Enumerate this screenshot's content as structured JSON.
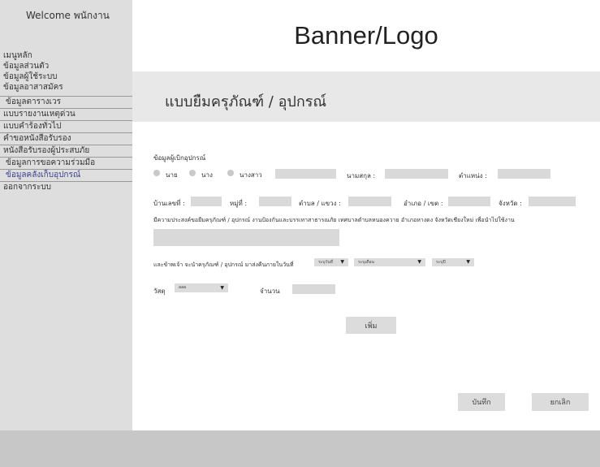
{
  "sidebar": {
    "welcome": "Welcome พนักงาน",
    "items": [
      {
        "label": "เมนูหลัก"
      },
      {
        "label": "ข้อมูลส่วนตัว"
      },
      {
        "label": "ข้อมูลผู้ใช้ระบบ"
      },
      {
        "label": "ข้อมูลอาสาสมัคร"
      },
      {
        "label": "ข้อมูลตารางเวร"
      },
      {
        "label": "แบบรายงานเหตุด่วน"
      },
      {
        "label": "แบบคำร้องทั่วไป"
      },
      {
        "label": "คำขอหนังสือรับรอง"
      },
      {
        "label": "หนังสือรับรองผู้ประสบภัย"
      },
      {
        "label": "ข้อมูลการขอความร่วมมือ"
      },
      {
        "label": "ข้อมูลคลังเก็บอุปกรณ์"
      },
      {
        "label": "ออกจากระบบ"
      }
    ]
  },
  "banner": {
    "text": "Banner/Logo"
  },
  "page": {
    "title": "แบบยืมครุภัณฑ์ / อุปกรณ์"
  },
  "form": {
    "section_label": "ข้อมูลผู้เบิกอุปกรณ์",
    "prefix_options": [
      "นาย",
      "นาง",
      "นางสาว"
    ],
    "surname_label": "นามสกุล :",
    "position_label": "ตำแหน่ง :",
    "house_no_label": "บ้านเลขที่ :",
    "moo_label": "หมู่ที่ :",
    "subdistrict_label": "ตำบล / แขวง :",
    "district_label": "อำเภอ / เขต :",
    "province_label": "จังหวัด :",
    "purpose_text": "มีความประสงค์ขอยืมครุภัณฑ์ / อุปกรณ์ งานป้องกันและบรรเทาสาธารณภัย เทศบาลตำบลหนองควาย อำเภอหางดง จังหวัดเชียงใหม่ เพื่อนำไปใช้งาน",
    "return_text": "และข้าพเจ้า จะนำครุภัณฑ์ / อุปกรณ์ มาส่งคืนภายในวันที่",
    "date_selects": [
      {
        "value": "ระบุวันที่"
      },
      {
        "value": "ระบุเดือน"
      },
      {
        "value": "ระบุปี"
      }
    ],
    "material_label": "วัสดุ",
    "material_value": "aaa",
    "quantity_label": "จำนวน",
    "add_button": "เพิ่ม",
    "save_button": "บันทึก",
    "cancel_button": "ยกเลิก"
  }
}
